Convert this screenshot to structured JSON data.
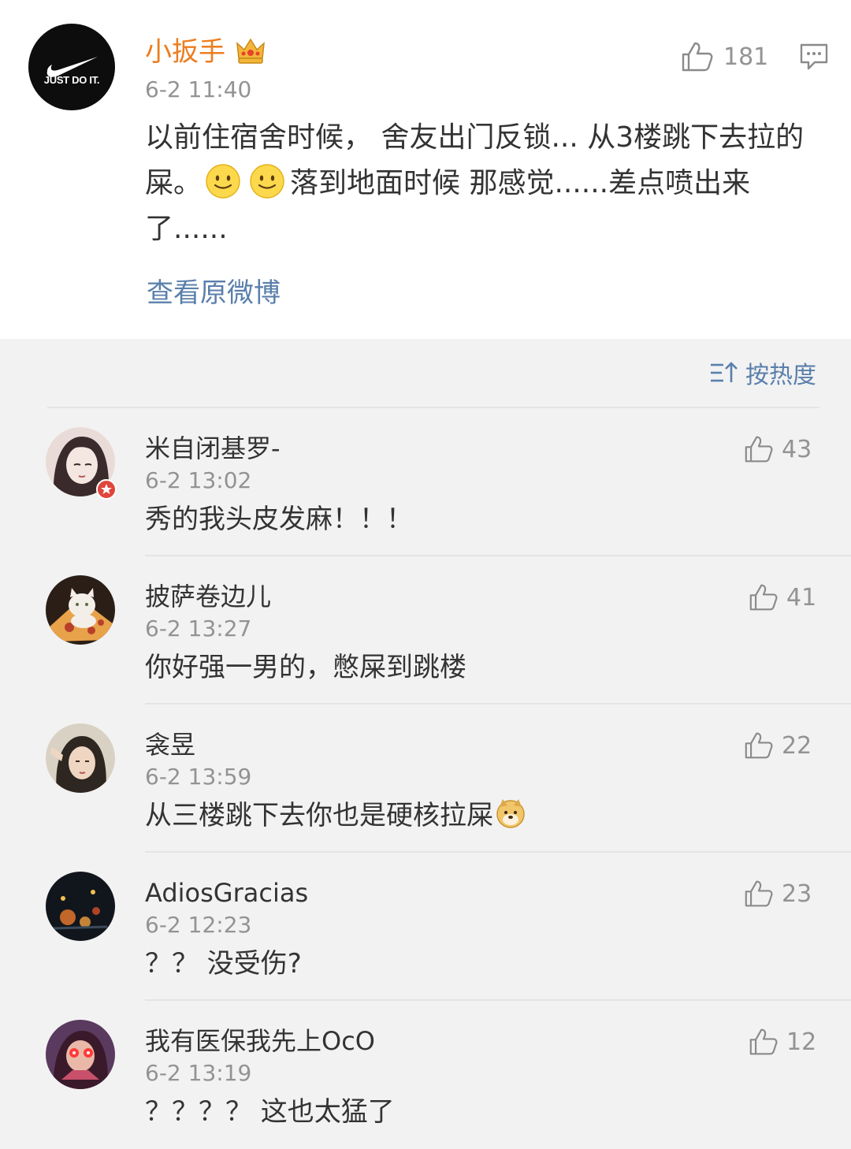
{
  "post": {
    "author": "小扳手",
    "time": "6-2 11:40",
    "avatar_text": "JUST DO IT.",
    "likes": "181",
    "text_part1": "以前住宿舍时候， 舍友出门反锁... 从3楼跳下去拉的屎。",
    "text_part2": "落到地面时候 那感觉......差点喷出来了......",
    "view_original": "查看原微博",
    "icons": [
      "crown-icon",
      "thumbs-up-icon",
      "comment-icon",
      "smile-emoji",
      "smile-emoji"
    ]
  },
  "sort": {
    "label": "按热度",
    "icon": "sort-icon"
  },
  "comments": [
    {
      "name": "米自闭基罗-",
      "time": "6-2 13:02",
      "text": "秀的我头皮发麻！！！",
      "likes": "43"
    },
    {
      "name": "披萨卷边儿",
      "time": "6-2 13:27",
      "text": "你好强一男的，憋屎到跳楼",
      "likes": "41"
    },
    {
      "name": "衾昱",
      "time": "6-2 13:59",
      "text": "从三楼跳下去你也是硬核拉屎",
      "likes": "22"
    },
    {
      "name": "AdiosGracias",
      "time": "6-2 12:23",
      "text": "？？ 没受伤?",
      "likes": "23"
    },
    {
      "name": "我有医保我先上OcO",
      "time": "6-2 13:19",
      "text": "？？？？ 这也太猛了",
      "likes": "12"
    }
  ],
  "colors": {
    "author_orange": "#ec7d1e",
    "link_blue": "#5a7fab",
    "muted_gray": "#939393",
    "text": "#333333",
    "background": "#f2f2f2"
  }
}
